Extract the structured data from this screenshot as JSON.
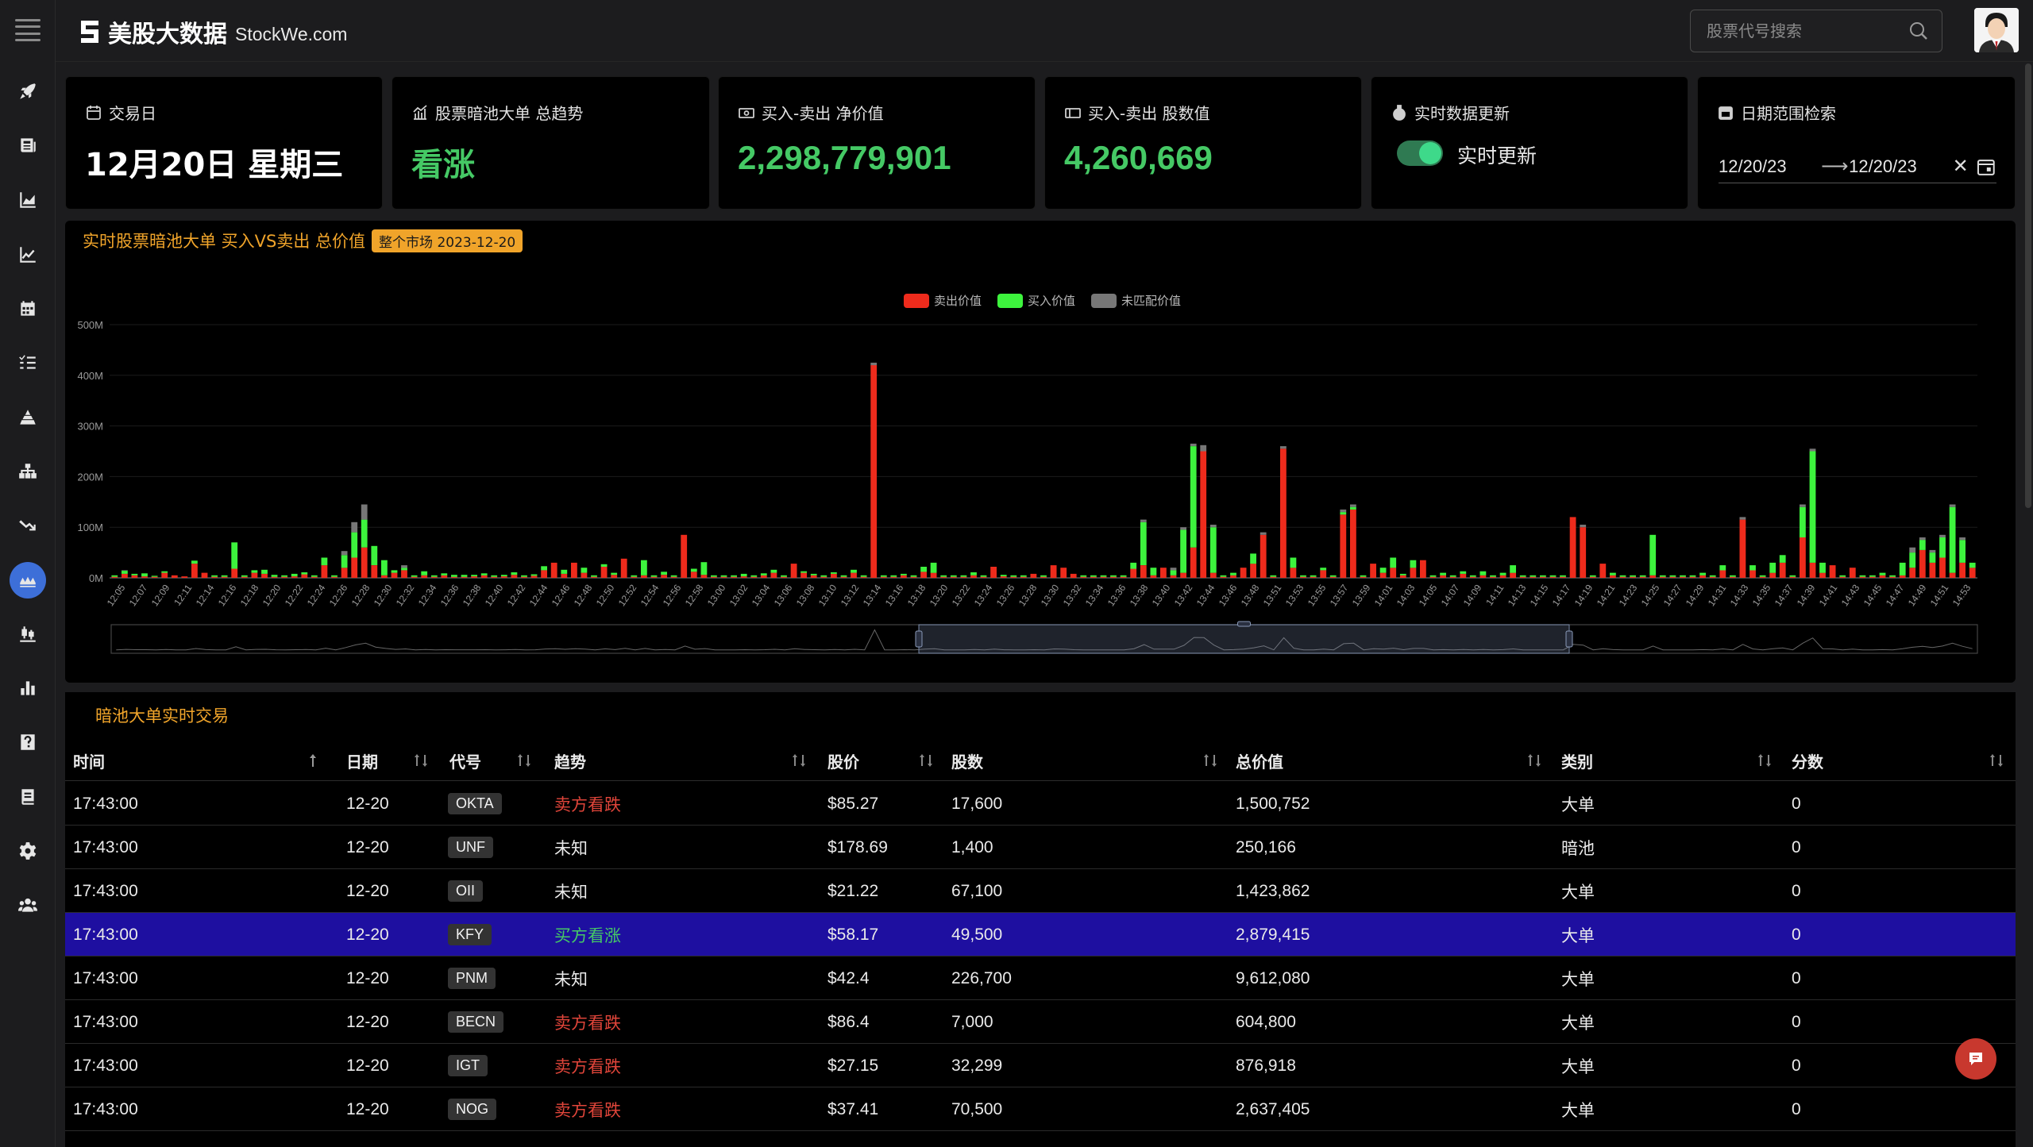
{
  "app": {
    "logo_title": "美股大数据",
    "logo_sub": "StockWe.com"
  },
  "search": {
    "placeholder": "股票代号搜索"
  },
  "cards": {
    "trade_day": {
      "title": "交易日",
      "value": "12月20日 星期三"
    },
    "trend": {
      "title": "股票暗池大单 总趋势",
      "value": "看涨"
    },
    "net_value": {
      "title": "买入-卖出 净价值",
      "value": "2,298,779,901"
    },
    "net_shares": {
      "title": "买入-卖出 股数值",
      "value": "4,260,669"
    },
    "realtime": {
      "title": "实时数据更新",
      "toggle_label": "实时更新",
      "enabled": true
    },
    "date_range": {
      "title": "日期范围检索",
      "from": "12/20/23",
      "to": "12/20/23",
      "arrow": "⟶",
      "clear": "✕"
    }
  },
  "colors": {
    "sell": "#ee2b1c",
    "buy": "#3df33d",
    "unmatched": "#777777",
    "accent": "#f0a42a",
    "up_text": "#45c965",
    "down_text": "#e0453a"
  },
  "chart_title": "实时股票暗池大单 买入VS卖出 总价值",
  "chart_badge": "整个市场 2023-12-20",
  "chart_data": {
    "type": "bar",
    "stacked": true,
    "legend": [
      "卖出价值",
      "买入价值",
      "未匹配价值"
    ],
    "legend_position": "top-center",
    "y_ticks": [
      "0M",
      "100M",
      "200M",
      "300M",
      "400M",
      "500M"
    ],
    "ylim": [
      0,
      500
    ],
    "unit": "M",
    "x_tick_labels": [
      "12:05",
      "12:07",
      "12:09",
      "12:11",
      "12:14",
      "12:16",
      "12:18",
      "12:20",
      "12:22",
      "12:24",
      "12:26",
      "12:28",
      "12:30",
      "12:32",
      "12:34",
      "12:36",
      "12:38",
      "12:40",
      "12:42",
      "12:44",
      "12:46",
      "12:48",
      "12:50",
      "12:52",
      "12:54",
      "12:56",
      "12:58",
      "13:00",
      "13:02",
      "13:04",
      "13:06",
      "13:08",
      "13:10",
      "13:12",
      "13:14",
      "13:16",
      "13:18",
      "13:20",
      "13:22",
      "13:24",
      "13:26",
      "13:28",
      "13:30",
      "13:32",
      "13:34",
      "13:36",
      "13:38",
      "13:40",
      "13:42",
      "13:44",
      "13:46",
      "13:48",
      "13:51",
      "13:53",
      "13:55",
      "13:57",
      "13:59",
      "14:01",
      "14:03",
      "14:05",
      "14:07",
      "14:09",
      "14:11",
      "14:13",
      "14:15",
      "14:17",
      "14:19",
      "14:21",
      "14:23",
      "14:25",
      "14:27",
      "14:29",
      "14:31",
      "14:33",
      "14:35",
      "14:37",
      "14:39",
      "14:41",
      "14:43",
      "14:45",
      "14:47",
      "14:49",
      "14:51",
      "14:53"
    ],
    "slot_values": [
      [
        2,
        3,
        0
      ],
      [
        8,
        6,
        1
      ],
      [
        5,
        3,
        0
      ],
      [
        3,
        6,
        0
      ],
      [
        2,
        2,
        0
      ],
      [
        10,
        3,
        0
      ],
      [
        5,
        0,
        0
      ],
      [
        3,
        0,
        0
      ],
      [
        28,
        6,
        0
      ],
      [
        10,
        0,
        0
      ],
      [
        2,
        3,
        0
      ],
      [
        2,
        3,
        0
      ],
      [
        18,
        52,
        0
      ],
      [
        2,
        3,
        0
      ],
      [
        10,
        5,
        0
      ],
      [
        8,
        8,
        0
      ],
      [
        2,
        4,
        0
      ],
      [
        2,
        3,
        0
      ],
      [
        3,
        5,
        0
      ],
      [
        7,
        4,
        0
      ],
      [
        2,
        3,
        0
      ],
      [
        25,
        15,
        0
      ],
      [
        2,
        3,
        0
      ],
      [
        20,
        25,
        8
      ],
      [
        40,
        50,
        20
      ],
      [
        60,
        55,
        30
      ],
      [
        25,
        38,
        0
      ],
      [
        5,
        30,
        0
      ],
      [
        10,
        5,
        0
      ],
      [
        15,
        5,
        5
      ],
      [
        2,
        3,
        0
      ],
      [
        5,
        8,
        0
      ],
      [
        2,
        3,
        0
      ],
      [
        5,
        4,
        0
      ],
      [
        2,
        4,
        0
      ],
      [
        2,
        4,
        0
      ],
      [
        3,
        3,
        0
      ],
      [
        5,
        4,
        0
      ],
      [
        2,
        3,
        0
      ],
      [
        3,
        3,
        0
      ],
      [
        6,
        5,
        0
      ],
      [
        2,
        3,
        0
      ],
      [
        4,
        3,
        0
      ],
      [
        15,
        8,
        0
      ],
      [
        30,
        0,
        0
      ],
      [
        8,
        8,
        0
      ],
      [
        30,
        0,
        0
      ],
      [
        10,
        10,
        0
      ],
      [
        2,
        3,
        0
      ],
      [
        22,
        5,
        0
      ],
      [
        6,
        4,
        0
      ],
      [
        38,
        0,
        0
      ],
      [
        2,
        3,
        0
      ],
      [
        5,
        30,
        0
      ],
      [
        2,
        3,
        0
      ],
      [
        6,
        6,
        0
      ],
      [
        2,
        3,
        0
      ],
      [
        85,
        0,
        0
      ],
      [
        12,
        6,
        0
      ],
      [
        6,
        25,
        0
      ],
      [
        2,
        3,
        0
      ],
      [
        2,
        3,
        0
      ],
      [
        2,
        3,
        0
      ],
      [
        3,
        5,
        0
      ],
      [
        2,
        3,
        0
      ],
      [
        5,
        4,
        0
      ],
      [
        10,
        6,
        0
      ],
      [
        2,
        3,
        0
      ],
      [
        28,
        0,
        0
      ],
      [
        10,
        3,
        0
      ],
      [
        5,
        3,
        0
      ],
      [
        2,
        3,
        0
      ],
      [
        8,
        3,
        0
      ],
      [
        2,
        3,
        0
      ],
      [
        10,
        6,
        0
      ],
      [
        2,
        3,
        0
      ],
      [
        420,
        0,
        5
      ],
      [
        2,
        3,
        0
      ],
      [
        2,
        3,
        0
      ],
      [
        5,
        3,
        0
      ],
      [
        2,
        3,
        0
      ],
      [
        12,
        10,
        0
      ],
      [
        10,
        20,
        0
      ],
      [
        2,
        3,
        0
      ],
      [
        2,
        3,
        0
      ],
      [
        2,
        3,
        0
      ],
      [
        5,
        6,
        0
      ],
      [
        2,
        3,
        0
      ],
      [
        22,
        0,
        0
      ],
      [
        3,
        3,
        0
      ],
      [
        2,
        3,
        0
      ],
      [
        2,
        3,
        0
      ],
      [
        8,
        0,
        0
      ],
      [
        2,
        3,
        0
      ],
      [
        25,
        0,
        0
      ],
      [
        20,
        0,
        0
      ],
      [
        8,
        0,
        0
      ],
      [
        2,
        3,
        0
      ],
      [
        2,
        3,
        0
      ],
      [
        2,
        3,
        0
      ],
      [
        2,
        3,
        0
      ],
      [
        2,
        3,
        0
      ],
      [
        18,
        12,
        0
      ],
      [
        25,
        85,
        5
      ],
      [
        5,
        15,
        0
      ],
      [
        20,
        0,
        0
      ],
      [
        5,
        10,
        5
      ],
      [
        10,
        85,
        5
      ],
      [
        60,
        200,
        5
      ],
      [
        250,
        0,
        12
      ],
      [
        10,
        90,
        5
      ],
      [
        2,
        3,
        0
      ],
      [
        5,
        5,
        0
      ],
      [
        20,
        0,
        0
      ],
      [
        28,
        20,
        0
      ],
      [
        85,
        0,
        5
      ],
      [
        2,
        3,
        0
      ],
      [
        255,
        0,
        5
      ],
      [
        20,
        20,
        0
      ],
      [
        2,
        3,
        0
      ],
      [
        2,
        3,
        0
      ],
      [
        15,
        5,
        0
      ],
      [
        2,
        3,
        0
      ],
      [
        125,
        5,
        5
      ],
      [
        135,
        5,
        5
      ],
      [
        2,
        3,
        0
      ],
      [
        28,
        0,
        0
      ],
      [
        10,
        10,
        0
      ],
      [
        20,
        20,
        0
      ],
      [
        5,
        3,
        0
      ],
      [
        20,
        15,
        0
      ],
      [
        35,
        0,
        0
      ],
      [
        2,
        3,
        0
      ],
      [
        5,
        5,
        0
      ],
      [
        2,
        3,
        0
      ],
      [
        8,
        5,
        0
      ],
      [
        2,
        3,
        0
      ],
      [
        5,
        8,
        0
      ],
      [
        2,
        3,
        0
      ],
      [
        5,
        5,
        0
      ],
      [
        10,
        15,
        0
      ],
      [
        2,
        3,
        0
      ],
      [
        2,
        3,
        0
      ],
      [
        2,
        3,
        0
      ],
      [
        2,
        3,
        0
      ],
      [
        2,
        3,
        0
      ],
      [
        120,
        0,
        0
      ],
      [
        100,
        0,
        5
      ],
      [
        2,
        3,
        0
      ],
      [
        28,
        0,
        0
      ],
      [
        5,
        5,
        0
      ],
      [
        2,
        3,
        0
      ],
      [
        2,
        3,
        0
      ],
      [
        2,
        3,
        0
      ],
      [
        5,
        80,
        0
      ],
      [
        2,
        3,
        0
      ],
      [
        2,
        3,
        0
      ],
      [
        2,
        3,
        0
      ],
      [
        2,
        3,
        0
      ],
      [
        5,
        5,
        0
      ],
      [
        2,
        3,
        0
      ],
      [
        15,
        10,
        0
      ],
      [
        2,
        3,
        0
      ],
      [
        115,
        0,
        5
      ],
      [
        15,
        10,
        0
      ],
      [
        2,
        3,
        0
      ],
      [
        10,
        20,
        0
      ],
      [
        30,
        15,
        0
      ],
      [
        2,
        3,
        0
      ],
      [
        80,
        60,
        5
      ],
      [
        30,
        220,
        5
      ],
      [
        10,
        20,
        0
      ],
      [
        25,
        0,
        0
      ],
      [
        2,
        3,
        0
      ],
      [
        20,
        0,
        0
      ],
      [
        2,
        3,
        0
      ],
      [
        2,
        3,
        0
      ],
      [
        5,
        5,
        0
      ],
      [
        2,
        3,
        0
      ],
      [
        5,
        25,
        0
      ],
      [
        20,
        30,
        10
      ],
      [
        55,
        20,
        5
      ],
      [
        30,
        20,
        5
      ],
      [
        40,
        40,
        5
      ],
      [
        10,
        130,
        5
      ],
      [
        30,
        45,
        5
      ],
      [
        20,
        10,
        0
      ]
    ],
    "navigator_window": "13:18 - 14:11"
  },
  "table": {
    "title": "暗池大单实时交易",
    "columns": [
      "时间",
      "日期",
      "代号",
      "趋势",
      "股价",
      "股数",
      "总价值",
      "类别",
      "分数"
    ],
    "rows": [
      {
        "time": "17:43:00",
        "date": "12-20",
        "symbol": "OKTA",
        "trend": "卖方看跌",
        "trend_type": "down",
        "price": "$85.27",
        "shares": "17,600",
        "value": "1,500,752",
        "category": "大单",
        "score": "0"
      },
      {
        "time": "17:43:00",
        "date": "12-20",
        "symbol": "UNF",
        "trend": "未知",
        "trend_type": "unk",
        "price": "$178.69",
        "shares": "1,400",
        "value": "250,166",
        "category": "暗池",
        "score": "0"
      },
      {
        "time": "17:43:00",
        "date": "12-20",
        "symbol": "OII",
        "trend": "未知",
        "trend_type": "unk",
        "price": "$21.22",
        "shares": "67,100",
        "value": "1,423,862",
        "category": "大单",
        "score": "0"
      },
      {
        "time": "17:43:00",
        "date": "12-20",
        "symbol": "KFY",
        "trend": "买方看涨",
        "trend_type": "up",
        "price": "$58.17",
        "shares": "49,500",
        "value": "2,879,415",
        "category": "大单",
        "score": "0",
        "selected": true
      },
      {
        "time": "17:43:00",
        "date": "12-20",
        "symbol": "PNM",
        "trend": "未知",
        "trend_type": "unk",
        "price": "$42.4",
        "shares": "226,700",
        "value": "9,612,080",
        "category": "大单",
        "score": "0"
      },
      {
        "time": "17:43:00",
        "date": "12-20",
        "symbol": "BECN",
        "trend": "卖方看跌",
        "trend_type": "down",
        "price": "$86.4",
        "shares": "7,000",
        "value": "604,800",
        "category": "大单",
        "score": "0"
      },
      {
        "time": "17:43:00",
        "date": "12-20",
        "symbol": "IGT",
        "trend": "卖方看跌",
        "trend_type": "down",
        "price": "$27.15",
        "shares": "32,299",
        "value": "876,918",
        "category": "大单",
        "score": "0"
      },
      {
        "time": "17:43:00",
        "date": "12-20",
        "symbol": "NOG",
        "trend": "卖方看跌",
        "trend_type": "down",
        "price": "$37.41",
        "shares": "70,500",
        "value": "2,637,405",
        "category": "大单",
        "score": "0"
      }
    ]
  },
  "sidebar": {
    "items": [
      {
        "icon": "rocket-icon"
      },
      {
        "icon": "newspaper-icon"
      },
      {
        "icon": "area-chart-icon"
      },
      {
        "icon": "line-chart-icon"
      },
      {
        "icon": "calendar-icon"
      },
      {
        "icon": "list-check-icon"
      },
      {
        "icon": "pyramid-icon"
      },
      {
        "icon": "sitemap-icon"
      },
      {
        "icon": "trend-down-icon"
      },
      {
        "icon": "water-icon",
        "active": true
      },
      {
        "icon": "candles-icon"
      },
      {
        "icon": "bar-chart-icon"
      },
      {
        "icon": "question-icon"
      },
      {
        "icon": "book-icon"
      },
      {
        "icon": "gear-icon"
      },
      {
        "icon": "users-icon"
      }
    ]
  }
}
